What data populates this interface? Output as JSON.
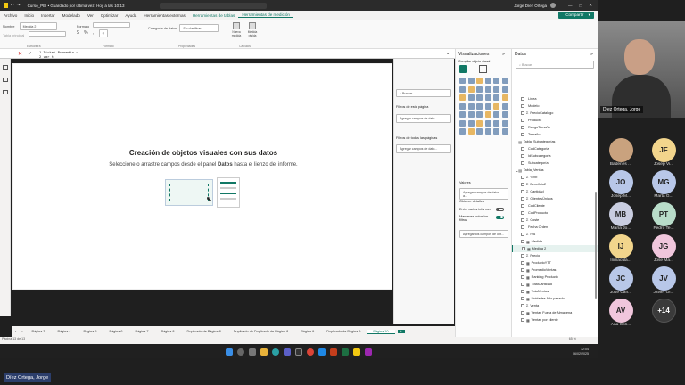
{
  "window": {
    "title": "Curso_PBI • Guardado por última vez: Hoy a las 10:13",
    "user": "Jorge Díez Ortega",
    "window_controls": [
      "—",
      "□",
      "✕"
    ]
  },
  "menu": [
    "Archivo",
    "Inicio",
    "Insertar",
    "Modelado",
    "Ver",
    "Optimizar",
    "Ayuda",
    "Herramientas externas",
    "Herramientas de tablas",
    "Herramientas de medición"
  ],
  "share_label": "Compartir",
  "ribbon": {
    "name_label": "Nombre",
    "name_value": "Medida 2",
    "home_table_label": "Tabla principal",
    "format_label": "Formato",
    "currency": "$",
    "percent": "%",
    "comma": ",",
    "decimals_label": "0",
    "data_category_label": "Categoría de datos",
    "data_category_value": "Sin clasificar",
    "new_measure_label": "Nueva medida",
    "quick_measure_label": "Medida rápida",
    "groups": [
      "Estructura",
      "Formato",
      "Propiedades",
      "Cálculos"
    ]
  },
  "formula": {
    "line1": "1  Ticket Promedio =",
    "line2": "2  var t"
  },
  "canvas": {
    "title": "Creación de objetos visuales con sus datos",
    "subtitle_pre": "Seleccione o arrastre campos desde el panel ",
    "subtitle_bold": "Datos",
    "subtitle_post": " hasta el lienzo del informe."
  },
  "filters": {
    "search_placeholder": "Buscar",
    "page_title": "Filtros de esta página",
    "add_fields": "Agregar campos de dato...",
    "all_pages_title": "Filtros de todas las páginas",
    "add_fields_all": "Agregar campos de dato..."
  },
  "viz": {
    "title": "Visualizaciones",
    "build": "Compilar objeto visual",
    "values": "Valores",
    "add_data": "Agregar campos de datos a...",
    "drill": "Obtener detalles",
    "cross_report": "Entre varios informes",
    "keep_filters": "Mantener todos los filtros",
    "add_drill": "Agregar los campos de obt...",
    "cross_toggle": "off",
    "keep_toggle": "on"
  },
  "data": {
    "title": "Datos",
    "search_placeholder": "Buscar",
    "items": [
      {
        "label": "Línea",
        "type": "field",
        "checked": false
      },
      {
        "label": "Modelo",
        "type": "field",
        "checked": false
      },
      {
        "label": "PrecioCatalogo",
        "type": "measure",
        "checked": false
      },
      {
        "label": "Producto",
        "type": "field",
        "checked": false
      },
      {
        "label": "RangoTamaño",
        "type": "field",
        "checked": false
      },
      {
        "label": "Tamaño",
        "type": "field",
        "checked": false
      },
      {
        "label": "Tabla_Subcategorías",
        "type": "table",
        "checked": false
      },
      {
        "label": "CodCategoria",
        "type": "field",
        "checked": false
      },
      {
        "label": "IdSubcategoria",
        "type": "field",
        "checked": false
      },
      {
        "label": "Subcategoría",
        "type": "field",
        "checked": false
      },
      {
        "label": "Tabla_Ventas",
        "type": "table",
        "checked": false
      },
      {
        "label": "%Vb",
        "type": "measure",
        "checked": false
      },
      {
        "label": "Beneficio2",
        "type": "measure",
        "checked": false
      },
      {
        "label": "Cantidad",
        "type": "measure",
        "checked": false
      },
      {
        "label": "ClientesÚnicos",
        "type": "measure",
        "checked": false
      },
      {
        "label": "CodCliente",
        "type": "field",
        "checked": false
      },
      {
        "label": "CodProducto",
        "type": "field",
        "checked": false
      },
      {
        "label": "Coste",
        "type": "measure",
        "checked": false
      },
      {
        "label": "Fecha Orden",
        "type": "field",
        "checked": false
      },
      {
        "label": "IVA",
        "type": "measure",
        "checked": false
      },
      {
        "label": "Medida",
        "type": "calc",
        "checked": false
      },
      {
        "label": "Medida 2",
        "type": "calc",
        "checked": false
      },
      {
        "label": "Precio",
        "type": "measure",
        "checked": false
      },
      {
        "label": "ProductoYTT",
        "type": "calc",
        "checked": false
      },
      {
        "label": "PromedioVentas",
        "type": "calc",
        "checked": false
      },
      {
        "label": "Ranking Producto",
        "type": "calc",
        "checked": false
      },
      {
        "label": "TotalCantidad",
        "type": "calc",
        "checked": false
      },
      {
        "label": "TotalVentas",
        "type": "calc",
        "checked": false
      },
      {
        "label": "Unidades Año pasado",
        "type": "calc",
        "checked": false
      },
      {
        "label": "Venta",
        "type": "measure",
        "checked": false
      },
      {
        "label": "Ventas Fuera de Almacena",
        "type": "calc",
        "checked": false
      },
      {
        "label": "Ventas por cliente",
        "type": "calc",
        "checked": false
      }
    ]
  },
  "tabs": [
    "Página 3",
    "Página 4",
    "Página 5",
    "Página 6",
    "Página 7",
    "Página 8",
    "Duplicado de Página 8",
    "Duplicado de Duplicado de Página 8",
    "Página 9",
    "Duplicado de Página 9",
    "Página 10"
  ],
  "active_tab": "Página 10",
  "add_tab": "+",
  "status": {
    "page": "Página 13 de 13",
    "zoom": "65 %"
  },
  "clock": {
    "time": "12:04",
    "date": "06/02/2025"
  },
  "webcam_name": "Díez Ortega, Jorge",
  "participants": [
    {
      "initials": "",
      "name": "Badenes ...",
      "color": "#c9a27e",
      "photo": true
    },
    {
      "initials": "JF",
      "name": "Josep Vi...",
      "color": "#f2d58c"
    },
    {
      "initials": "JO",
      "name": "Josep M...",
      "color": "#b8c7e8"
    },
    {
      "initials": "MG",
      "name": "Marta G...",
      "color": "#b8c7e8"
    },
    {
      "initials": "MB",
      "name": "María Jo...",
      "color": "#c9cde0"
    },
    {
      "initials": "PT",
      "name": "Pedro Te...",
      "color": "#b8dcc9"
    },
    {
      "initials": "IJ",
      "name": "Inmacula...",
      "color": "#f2d58c"
    },
    {
      "initials": "JG",
      "name": "Jose Ma...",
      "color": "#f0c6dc"
    },
    {
      "initials": "JC",
      "name": "Jose Carl...",
      "color": "#b8c7e8"
    },
    {
      "initials": "JV",
      "name": "Javier Ol...",
      "color": "#b8c7e8"
    },
    {
      "initials": "AV",
      "name": "Ana Colí...",
      "color": "#f0c6dc"
    },
    {
      "initials": "+14",
      "name": "",
      "color": "#3a3a3a"
    }
  ],
  "bottom_name": "Díez Ortega, Jorge",
  "colors": {
    "accent": "#117865",
    "teams_bg": "#1f1f1f"
  }
}
